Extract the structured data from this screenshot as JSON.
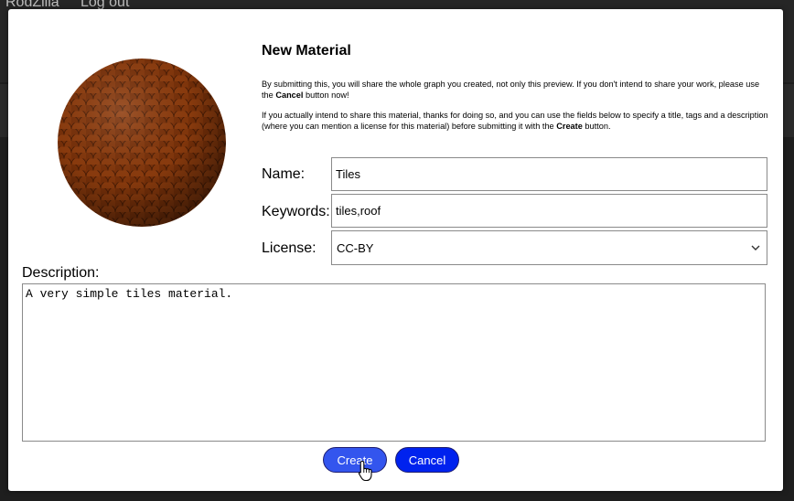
{
  "header": {
    "user_name": "RodZilla",
    "logout_label": "Log out"
  },
  "dialog": {
    "title": "New Material",
    "paragraph1": {
      "before": "By submitting this, you will share the whole graph you created, not only this preview. If you don't intend to share your work, please use the ",
      "bold": "Cancel",
      "after": " button now!"
    },
    "paragraph2": {
      "before": "If you actually intend to share this material, thanks for doing so, and you can use the fields below to specify a title, tags and a description (where you can mention a license for this material) before submitting it with the ",
      "bold": "Create",
      "after": " button."
    },
    "form": {
      "name_label": "Name:",
      "name_value": "Tiles",
      "keywords_label": "Keywords:",
      "keywords_value": "tiles,roof",
      "license_label": "License:",
      "license_value": "CC-BY",
      "description_label": "Description:",
      "description_value": "A very simple tiles material."
    },
    "buttons": {
      "create_label": "Create",
      "cancel_label": "Cancel"
    }
  },
  "colors": {
    "create_button": "#3355ee",
    "cancel_button": "#0022ee",
    "material_base": "#8a3a0c"
  },
  "icons": {
    "license_dropdown": "chevron-down-icon",
    "cursor": "hand-pointer-icon"
  }
}
